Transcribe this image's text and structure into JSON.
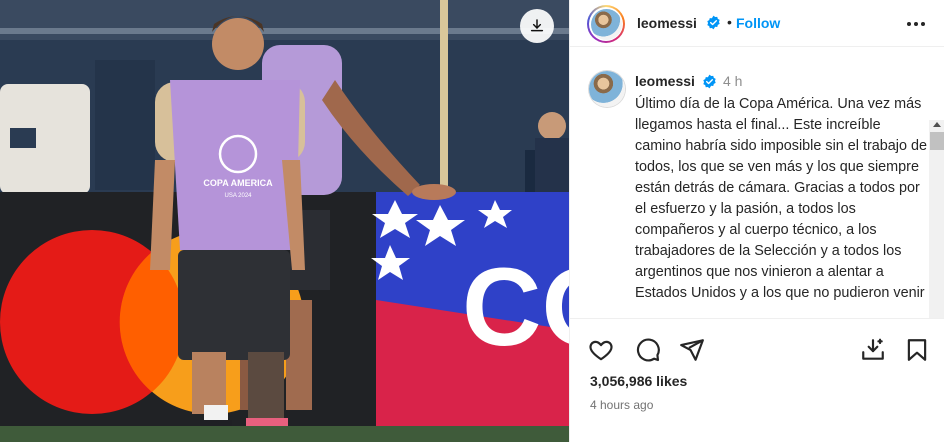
{
  "post": {
    "username": "leomessi",
    "follow_label": "Follow",
    "dot": "•",
    "caption_time": "4 h",
    "caption": "Último día de la Copa América. Una vez más llegamos hasta el final... Este increíble camino habría sido imposible sin el trabajo de todos, los que se ven más y los que siempre están detrás de cámara. Gracias a todos por el esfuerzo y la pasión, a todos los compañeros y al cuerpo técnico, a los trabajadores de la Selección y a todos los argentinos que nos vinieron a alentar a Estados Unidos y a los que no pudieron venir",
    "likes": "3,056,986 likes",
    "time_ago": "4 hours ago",
    "photo_text": {
      "bib_line1": "COPA AMERICA",
      "bib_line2": "USA 2024",
      "board": "CO"
    }
  },
  "icons": {
    "verified": "verified-badge-icon",
    "more": "more-options-icon",
    "like": "heart-icon",
    "comment": "comment-icon",
    "share": "share-icon",
    "save": "bookmark-icon",
    "download": "download-icon"
  },
  "colors": {
    "accent": "#0095f6",
    "text": "#262626",
    "muted": "#737373"
  }
}
